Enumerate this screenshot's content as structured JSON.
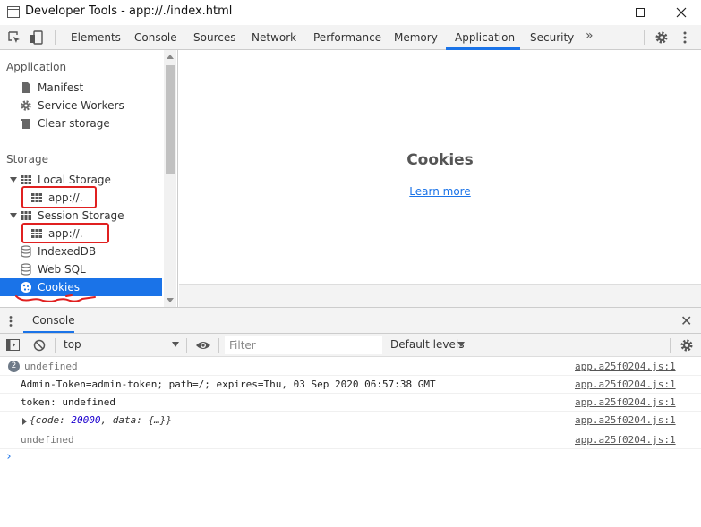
{
  "window": {
    "title": "Developer Tools - app://./index.html"
  },
  "tabs": {
    "elements": "Elements",
    "console": "Console",
    "sources": "Sources",
    "network": "Network",
    "performance": "Performance",
    "memory": "Memory",
    "application": "Application",
    "security": "Security",
    "more": "»"
  },
  "sidebar": {
    "application_header": "Application",
    "manifest": "Manifest",
    "service_workers": "Service Workers",
    "clear_storage": "Clear storage",
    "storage_header": "Storage",
    "local_storage": "Local Storage",
    "local_storage_child": "app://.",
    "session_storage": "Session Storage",
    "session_storage_child": "app://.",
    "indexeddb": "IndexedDB",
    "websql": "Web SQL",
    "cookies": "Cookies"
  },
  "main": {
    "title": "Cookies",
    "learn_more": "Learn more"
  },
  "drawer": {
    "console_tab": "Console",
    "close": "✕"
  },
  "console_toolbar": {
    "context": "top",
    "filter_placeholder": "Filter",
    "levels": "Default levels"
  },
  "console": {
    "lines": [
      {
        "badge": "2",
        "message": "undefined",
        "source": "app.a25f0204.js:1"
      },
      {
        "message": "Admin-Token=admin-token; path=/; expires=Thu, 03 Sep 2020 06:57:38 GMT",
        "source": "app.a25f0204.js:1"
      },
      {
        "message": "token: undefined",
        "source": "app.a25f0204.js:1"
      },
      {
        "obj_open": "{code: ",
        "obj_num": "20000",
        "obj_close": ", data: {…}}",
        "source": "app.a25f0204.js:1"
      },
      {
        "message": "undefined",
        "source": "app.a25f0204.js:1"
      }
    ],
    "prompt": "›"
  },
  "colors": {
    "accent": "#1a73e8",
    "annotation_red": "#e02020"
  }
}
